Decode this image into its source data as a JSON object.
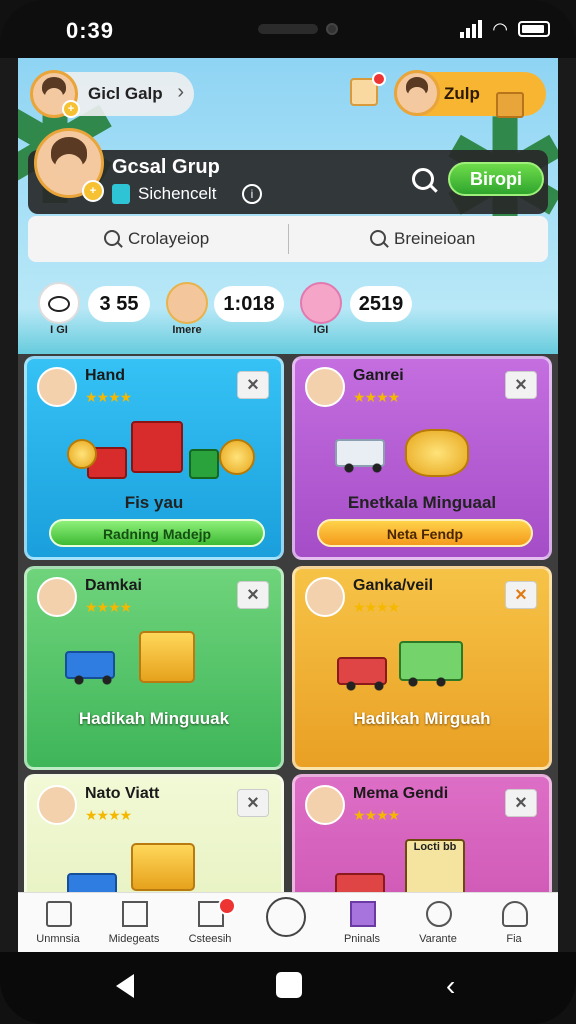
{
  "status_bar": {
    "time": "0:39"
  },
  "header": {
    "player_chip": {
      "label": "Gicl Galp"
    },
    "right_chip": {
      "label": "Zulp"
    }
  },
  "group": {
    "title": "Gcsal Grup",
    "subtitle": "Sichencelt",
    "action_button": "Biropi"
  },
  "search": {
    "left_label": "Crolayeiop",
    "right_label": "Breineioan"
  },
  "stats": [
    {
      "name": "I GI",
      "value": "3 55"
    },
    {
      "name": "Imere",
      "value": "1:018"
    },
    {
      "name": "IGI",
      "value": "2519"
    }
  ],
  "cards": [
    {
      "title": "Hand",
      "text": "Fis yau",
      "button": "Radning Madejp",
      "color": "#27b3ea"
    },
    {
      "title": "Ganrei",
      "text": "Enetkala Minguaal",
      "button": "Neta Fendp",
      "color": "#b75dd3"
    },
    {
      "title": "Damkai",
      "text": "Hadikah Minguuak",
      "color": "#56c469"
    },
    {
      "title": "Ganka/veil",
      "text": "Hadikah Mirguah",
      "color": "#f0b233"
    },
    {
      "title": "Nato Viatt",
      "color": "#eaf5c2"
    },
    {
      "title": "Mema Gendi",
      "badge": "Locti bb",
      "color": "#d25eb8"
    }
  ],
  "tabs": [
    "Unmnsia",
    "Midegeats",
    "Csteesih",
    "",
    "Pninals",
    "Varante",
    "Fia"
  ],
  "colors": {
    "accent_green": "#2fa52e",
    "gold": "#f7b531"
  }
}
